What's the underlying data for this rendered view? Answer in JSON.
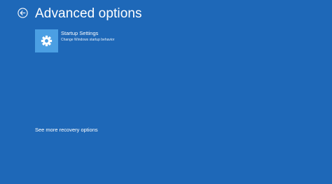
{
  "header": {
    "title": "Advanced options",
    "back_icon": "back-arrow-circle-icon"
  },
  "options": [
    {
      "title": "Startup Settings",
      "description": "Change Windows startup behavior",
      "icon": "gear-icon",
      "icon_bg": "#4b9fe3"
    }
  ],
  "footer": {
    "more_options_link": "See more recovery options"
  },
  "colors": {
    "background": "#1e68b8",
    "text": "#ffffff"
  }
}
